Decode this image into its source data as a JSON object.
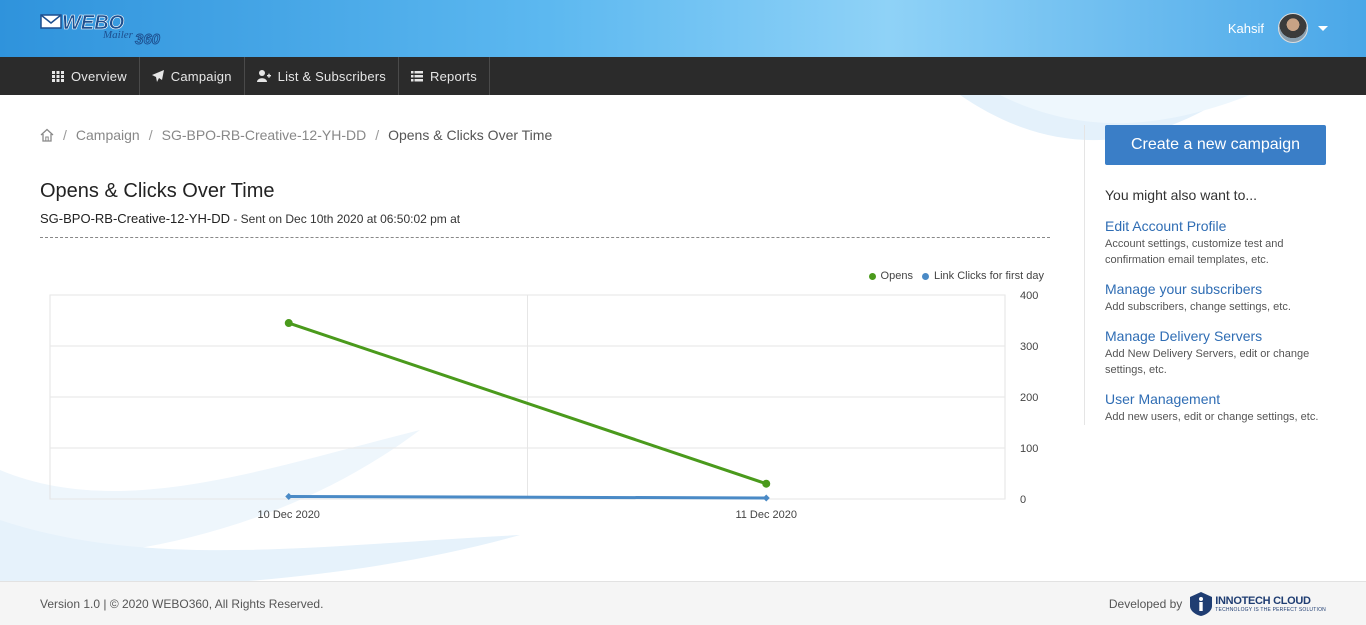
{
  "header": {
    "logo_text": "WEBO",
    "logo_sub": "Mailer",
    "logo_num": "360",
    "user_name": "Kahsif"
  },
  "nav": [
    {
      "label": "Overview",
      "icon": "grid-icon"
    },
    {
      "label": "Campaign",
      "icon": "paper-plane-icon"
    },
    {
      "label": "List & Subscribers",
      "icon": "user-plus-icon"
    },
    {
      "label": "Reports",
      "icon": "list-icon"
    }
  ],
  "breadcrumb": {
    "items": [
      "Campaign",
      "SG-BPO-RB-Creative-12-YH-DD"
    ],
    "current": "Opens & Clicks Over Time"
  },
  "page": {
    "title": "Opens & Clicks Over Time",
    "campaign": "SG-BPO-RB-Creative-12-YH-DD",
    "sent_info": " - Sent on Dec 10th 2020 at 06:50:02 pm at"
  },
  "chart_data": {
    "type": "line",
    "x": [
      "10 Dec 2020",
      "11 Dec 2020"
    ],
    "series": [
      {
        "name": "Opens",
        "values": [
          345,
          30
        ],
        "color": "#4a9a1c"
      },
      {
        "name": "Link Clicks for first day",
        "values": [
          5,
          2
        ],
        "color": "#4a8ac6"
      }
    ],
    "ylim": [
      0,
      400
    ],
    "yticks": [
      0,
      100,
      200,
      300,
      400
    ],
    "y_axis_side": "right",
    "grid": true,
    "legend": "top-right"
  },
  "sidebar": {
    "cta_label": "Create a new campaign",
    "heading": "You might also want to...",
    "links": [
      {
        "title": "Edit Account Profile",
        "desc": "Account settings, customize test and confirmation email templates, etc."
      },
      {
        "title": "Manage your subscribers",
        "desc": "Add subscribers, change settings, etc."
      },
      {
        "title": "Manage Delivery Servers",
        "desc": "Add New Delivery Servers, edit or change settings, etc."
      },
      {
        "title": "User Management",
        "desc": "Add new users, edit or change settings, etc."
      }
    ]
  },
  "footer": {
    "copyright": "Version 1.0 | © 2020 WEBO360, All Rights Reserved.",
    "developed_by": "Developed by",
    "dev_name": "INNOTECH CLOUD",
    "dev_tagline": "TECHNOLOGY IS THE PERFECT SOLUTION"
  },
  "colors": {
    "accent": "#3a7ec7",
    "nav_bg": "#2b2b2b",
    "link": "#2f6db4"
  }
}
